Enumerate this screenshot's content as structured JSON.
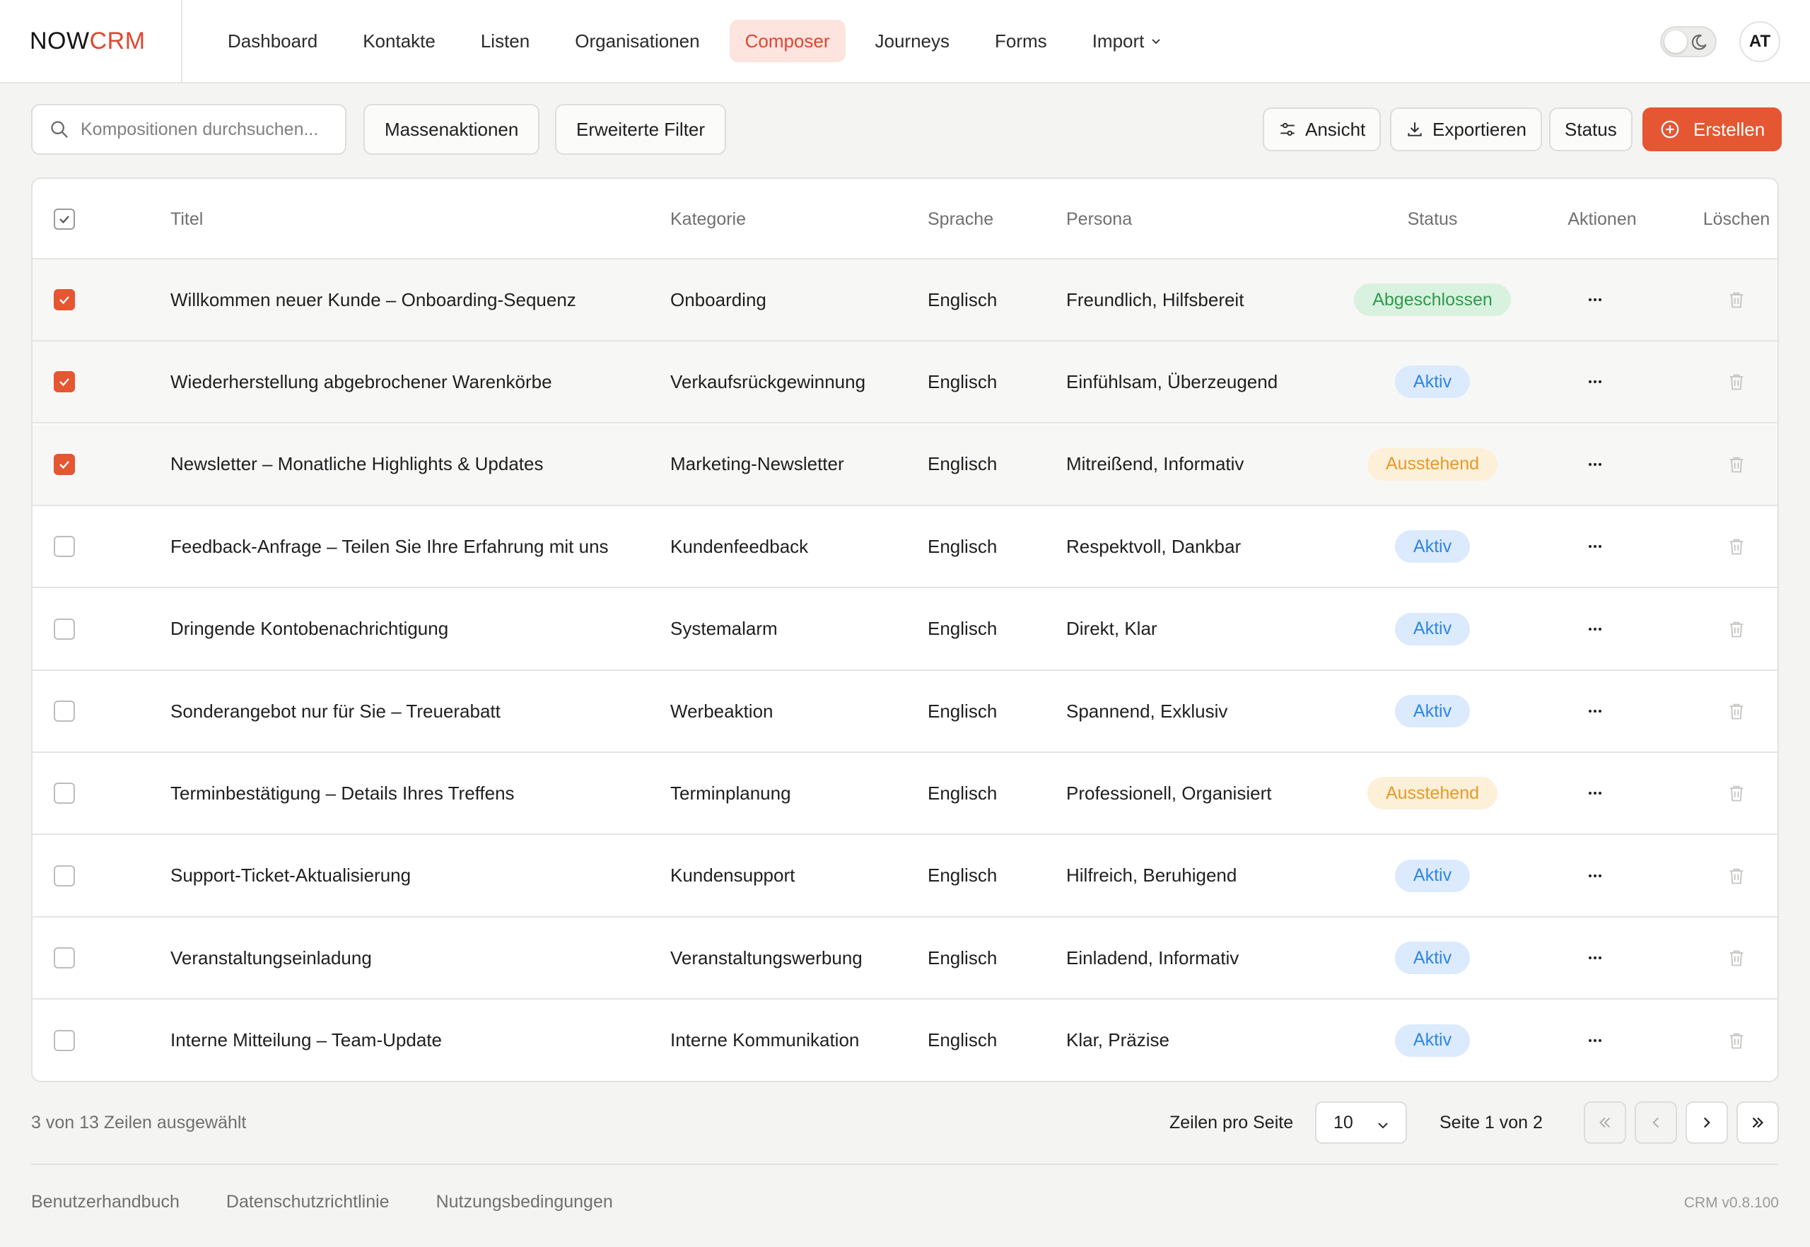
{
  "brand": {
    "part1": "NOW",
    "part2": "CRM"
  },
  "nav": {
    "items": [
      {
        "label": "Dashboard",
        "active": false
      },
      {
        "label": "Kontakte",
        "active": false
      },
      {
        "label": "Listen",
        "active": false
      },
      {
        "label": "Organisationen",
        "active": false
      },
      {
        "label": "Composer",
        "active": true
      },
      {
        "label": "Journeys",
        "active": false
      },
      {
        "label": "Forms",
        "active": false
      },
      {
        "label": "Import",
        "active": false,
        "has_dropdown": true
      }
    ]
  },
  "user": {
    "initials": "AT",
    "theme_toggle_icon": "moon-icon"
  },
  "toolbar": {
    "search_placeholder": "Kompositionen durchsuchen...",
    "bulk_actions": "Massenaktionen",
    "advanced_filters": "Erweiterte Filter",
    "view": "Ansicht",
    "export": "Exportieren",
    "status": "Status",
    "create": "Erstellen"
  },
  "table": {
    "headers": {
      "title": "Titel",
      "category": "Kategorie",
      "language": "Sprache",
      "persona": "Persona",
      "status": "Status",
      "actions": "Aktionen",
      "delete": "Löschen"
    },
    "rows": [
      {
        "selected": true,
        "title": "Willkommen neuer Kunde – Onboarding-Sequenz",
        "category": "Onboarding",
        "language": "Englisch",
        "persona": "Freundlich, Hilfsbereit",
        "status": "Abgeschlossen",
        "status_type": "done"
      },
      {
        "selected": true,
        "title": "Wiederherstellung abgebrochener Warenkörbe",
        "category": "Verkaufsrückgewinnung",
        "language": "Englisch",
        "persona": "Einfühlsam, Überzeugend",
        "status": "Aktiv",
        "status_type": "active"
      },
      {
        "selected": true,
        "title": "Newsletter – Monatliche Highlights & Updates",
        "category": "Marketing-Newsletter",
        "language": "Englisch",
        "persona": "Mitreißend, Informativ",
        "status": "Ausstehend",
        "status_type": "pending"
      },
      {
        "selected": false,
        "title": "Feedback-Anfrage – Teilen Sie Ihre Erfahrung mit uns",
        "category": "Kundenfeedback",
        "language": "Englisch",
        "persona": "Respektvoll, Dankbar",
        "status": "Aktiv",
        "status_type": "active"
      },
      {
        "selected": false,
        "title": "Dringende Kontobenachrichtigung",
        "category": "Systemalarm",
        "language": "Englisch",
        "persona": "Direkt, Klar",
        "status": "Aktiv",
        "status_type": "active"
      },
      {
        "selected": false,
        "title": "Sonderangebot nur für Sie – Treuerabatt",
        "category": "Werbeaktion",
        "language": "Englisch",
        "persona": "Spannend, Exklusiv",
        "status": "Aktiv",
        "status_type": "active"
      },
      {
        "selected": false,
        "title": "Terminbestätigung – Details Ihres Treffens",
        "category": "Terminplanung",
        "language": "Englisch",
        "persona": "Professionell, Organisiert",
        "status": "Ausstehend",
        "status_type": "pending"
      },
      {
        "selected": false,
        "title": "Support-Ticket-Aktualisierung",
        "category": "Kundensupport",
        "language": "Englisch",
        "persona": "Hilfreich, Beruhigend",
        "status": "Aktiv",
        "status_type": "active"
      },
      {
        "selected": false,
        "title": "Veranstaltungseinladung",
        "category": "Veranstaltungswerbung",
        "language": "Englisch",
        "persona": "Einladend, Informativ",
        "status": "Aktiv",
        "status_type": "active"
      },
      {
        "selected": false,
        "title": "Interne Mitteilung – Team-Update",
        "category": "Interne Kommunikation",
        "language": "Englisch",
        "persona": "Klar, Präzise",
        "status": "Aktiv",
        "status_type": "active"
      }
    ]
  },
  "pagination": {
    "selection_text": "3 von 13  Zeilen ausgewählt",
    "rows_per_page_label": "Zeilen pro Seite",
    "rows_per_page_value": "10",
    "page_text": "Seite 1  von  2"
  },
  "footer": {
    "links": [
      "Benutzerhandbuch",
      "Datenschutzrichtlinie",
      "Nutzungsbedingungen"
    ],
    "version": "CRM v0.8.100"
  },
  "colors": {
    "accent": "#e55632",
    "done_bg": "#d9f1df",
    "done_fg": "#2f9a4c",
    "active_bg": "#dbeafd",
    "active_fg": "#2f86e0",
    "pending_bg": "#fdf0d8",
    "pending_fg": "#e59a2a"
  }
}
